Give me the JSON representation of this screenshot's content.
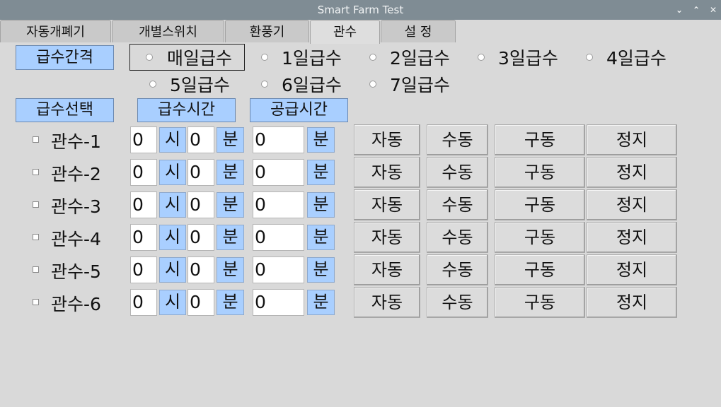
{
  "window": {
    "title": "Smart Farm Test",
    "controls": [
      "⌄",
      "⌃",
      "✕"
    ]
  },
  "tabs": [
    {
      "label": "자동개폐기",
      "active": false
    },
    {
      "label": "개별스위치",
      "active": false
    },
    {
      "label": "환풍기",
      "active": false
    },
    {
      "label": "관수",
      "active": true
    },
    {
      "label": "설 정",
      "active": false
    }
  ],
  "interval": {
    "label": "급수간격",
    "selected": "매일급수",
    "options": [
      "매일급수",
      "1일급수",
      "2일급수",
      "3일급수",
      "4일급수",
      "5일급수",
      "6일급수",
      "7일급수"
    ]
  },
  "headers": {
    "select": "급수선택",
    "time": "급수시간",
    "supply": "공급시간"
  },
  "units": {
    "hour": "시",
    "minute": "분"
  },
  "actions": {
    "auto": "자동",
    "manual": "수동",
    "run": "구동",
    "stop": "정지"
  },
  "rows": [
    {
      "label": "관수-1",
      "hour": "0",
      "minute": "0",
      "supply": "0",
      "checked": false
    },
    {
      "label": "관수-2",
      "hour": "0",
      "minute": "0",
      "supply": "0",
      "checked": false
    },
    {
      "label": "관수-3",
      "hour": "0",
      "minute": "0",
      "supply": "0",
      "checked": false
    },
    {
      "label": "관수-4",
      "hour": "0",
      "minute": "0",
      "supply": "0",
      "checked": false
    },
    {
      "label": "관수-5",
      "hour": "0",
      "minute": "0",
      "supply": "0",
      "checked": false
    },
    {
      "label": "관수-6",
      "hour": "0",
      "minute": "0",
      "supply": "0",
      "checked": false
    }
  ],
  "colors": {
    "titlebar": "#7f8c94",
    "accent_button": "#a9cfff",
    "background": "#d9d9d9"
  }
}
